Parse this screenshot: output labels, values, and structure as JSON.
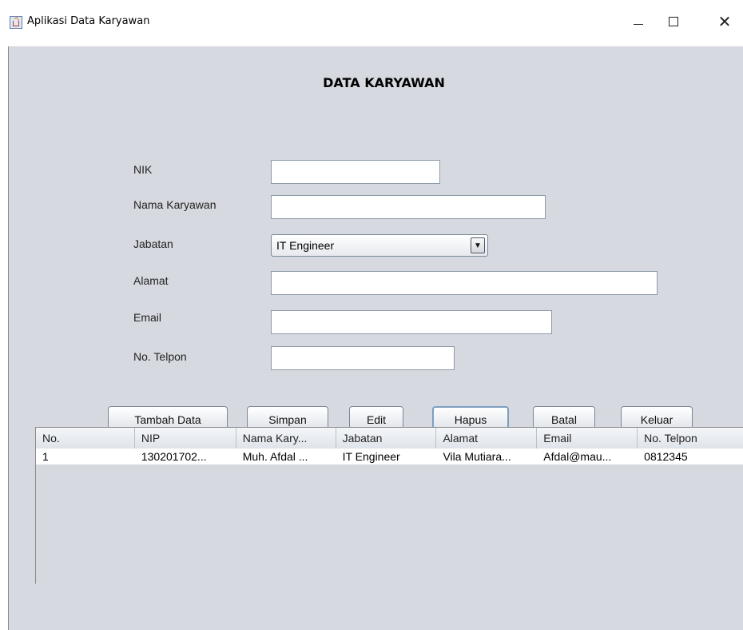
{
  "window": {
    "title": "Aplikasi Data Karyawan",
    "minimize_glyph": "",
    "close_glyph": "✕"
  },
  "form": {
    "heading": "DATA KARYAWAN",
    "fields": {
      "nik": {
        "label": "NIK",
        "value": ""
      },
      "nama": {
        "label": "Nama Karyawan",
        "value": ""
      },
      "jabatan": {
        "label": "Jabatan",
        "selected": "IT Engineer",
        "arrow": "▼"
      },
      "alamat": {
        "label": "Alamat",
        "value": ""
      },
      "email": {
        "label": "Email",
        "value": ""
      },
      "telpon": {
        "label": "No. Telpon",
        "value": ""
      }
    }
  },
  "buttons": {
    "tambah": "Tambah Data",
    "simpan": "Simpan",
    "edit": "Edit",
    "hapus": "Hapus",
    "batal": "Batal",
    "keluar": "Keluar"
  },
  "table": {
    "columns": [
      "No.",
      "NIP",
      "Nama Kary...",
      "Jabatan",
      "Alamat",
      "Email",
      "No. Telpon"
    ],
    "rows": [
      [
        "1",
        "130201702...",
        "Muh. Afdal ...",
        "IT Engineer",
        "Vila Mutiara...",
        "Afdal@mau...",
        "0812345"
      ]
    ]
  },
  "colors": {
    "panel_bg": "#d6d9df",
    "focus_border": "#7d9ec0"
  }
}
